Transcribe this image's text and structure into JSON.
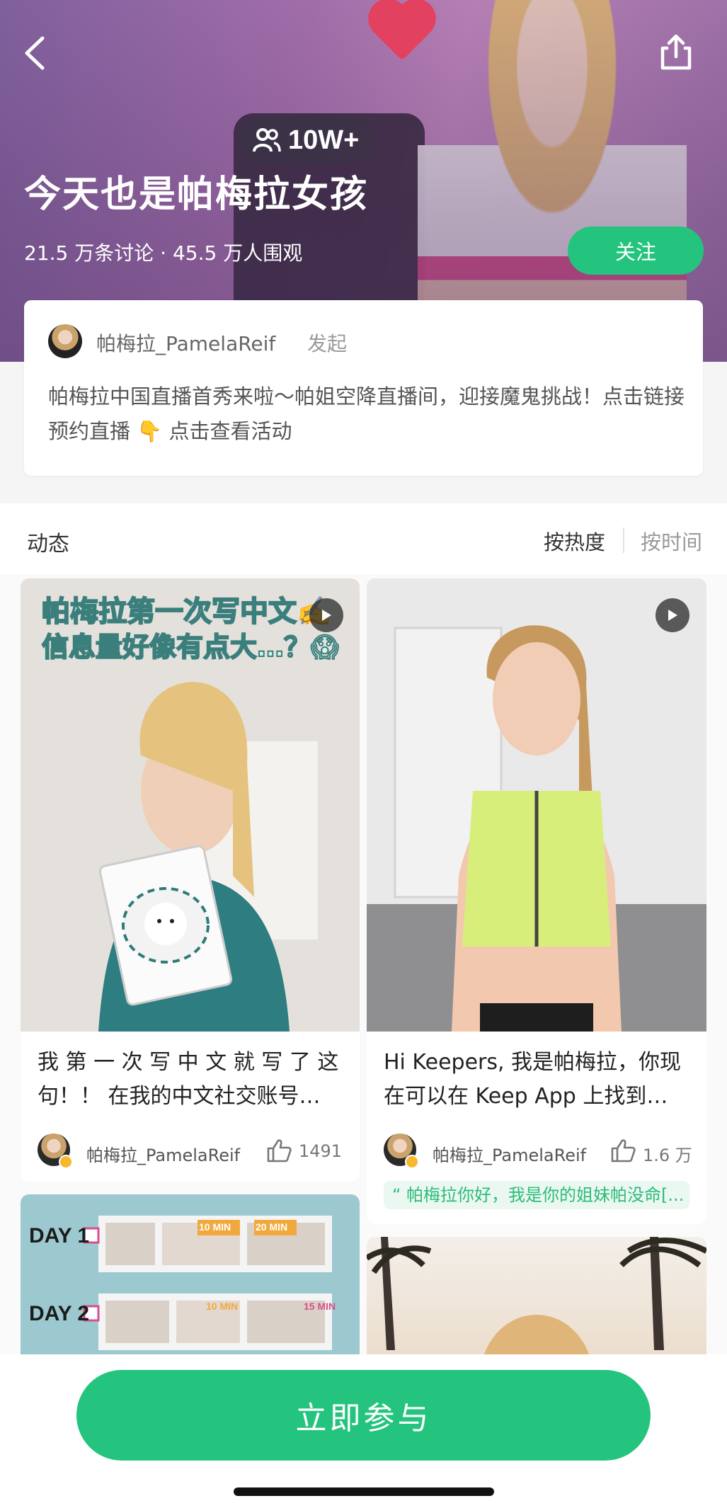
{
  "header": {
    "hero_badge": "10W+",
    "title": "今天也是帕梅拉女孩",
    "stats": "21.5 万条讨论 · 45.5 万人围观",
    "follow_label": "关注"
  },
  "intro": {
    "author": "帕梅拉_PamelaReif",
    "initiate_label": "发起",
    "description": "帕梅拉中国直播首秀来啦～帕姐空降直播间，迎接魔鬼挑战！点击链接预约直播 👇 点击查看活动"
  },
  "feed": {
    "label": "动态",
    "sort_hot": "按热度",
    "sort_time": "按时间",
    "posts": [
      {
        "image_caption_line1": "帕梅拉第一次写中文✍️",
        "image_caption_line2": "信息量好像有点大…？😱",
        "title": "我 第 一 次 写 中 文   就 写 了 这 句！！ 在我的中文社交账号…",
        "author": "帕梅拉_PamelaReif",
        "likes": "1491"
      },
      {
        "title": "Hi Keepers, 我是帕梅拉，你现在可以在 Keep App 上找到…",
        "author": "帕梅拉_PamelaReif",
        "likes": "1.6 万",
        "comment": "“ 帕梅拉你好，我是你的姐妹帕没命[..."
      },
      {
        "image_labels": [
          "DAY 1",
          "DAY 2",
          "10 MIN",
          "20 MIN",
          "10 MIN",
          "15 MIN"
        ]
      },
      {}
    ]
  },
  "bottom": {
    "join_label": "立即参与"
  },
  "colors": {
    "accent": "#24c47e",
    "header_bg": "#a77ab2",
    "comment_bg": "#eaf8f1"
  }
}
